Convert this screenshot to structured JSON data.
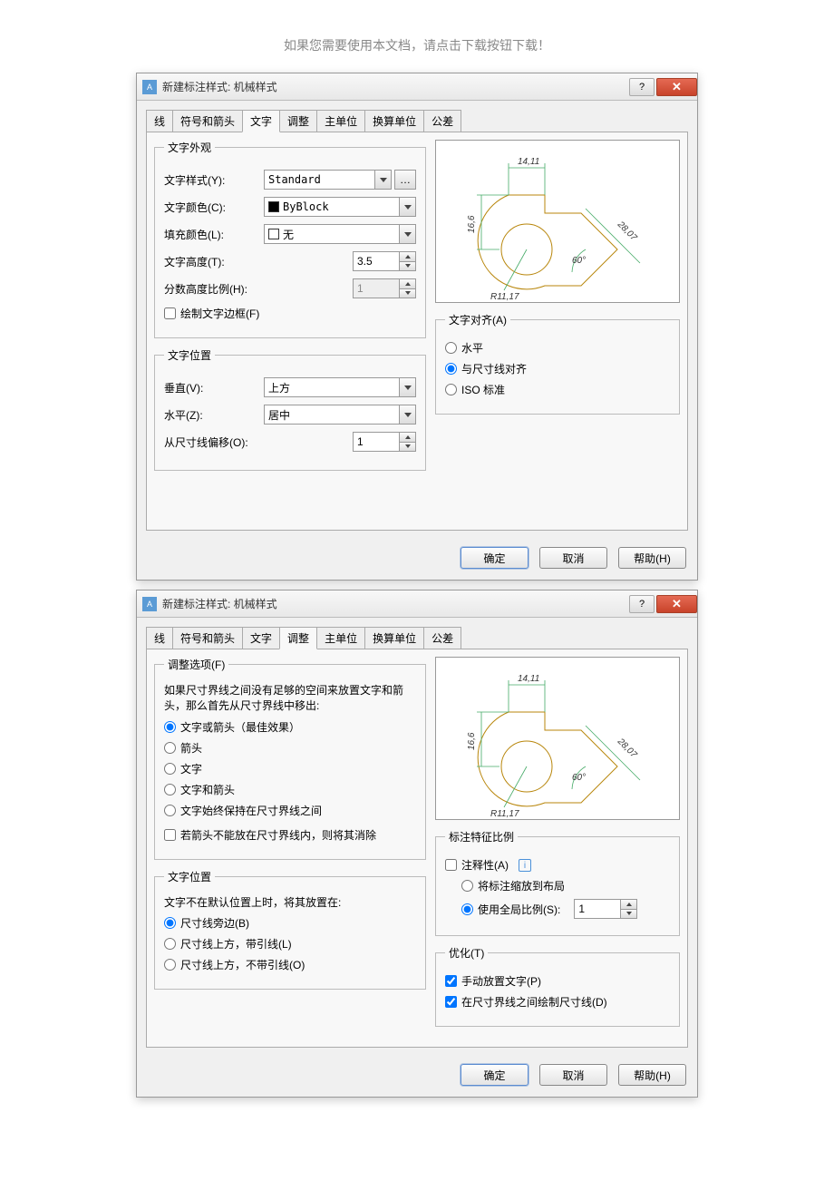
{
  "doc_notice": "如果您需要使用本文档，请点击下载按钮下载！",
  "dialog_title": "新建标注样式: 机械样式",
  "tabs": [
    "线",
    "符号和箭头",
    "文字",
    "调整",
    "主单位",
    "换算单位",
    "公差"
  ],
  "d1": {
    "active_tab": "文字",
    "appearance": {
      "legend": "文字外观",
      "style_label": "文字样式(Y):",
      "style_val": "Standard",
      "color_label": "文字颜色(C):",
      "color_val": "ByBlock",
      "fill_label": "填充颜色(L):",
      "fill_val": "无",
      "height_label": "文字高度(T):",
      "height_val": "3.5",
      "frac_label": "分数高度比例(H):",
      "frac_val": "1",
      "frame_check": "绘制文字边框(F)"
    },
    "position": {
      "legend": "文字位置",
      "vert_label": "垂直(V):",
      "vert_val": "上方",
      "horiz_label": "水平(Z):",
      "horiz_val": "居中",
      "offset_label": "从尺寸线偏移(O):",
      "offset_val": "1"
    },
    "align": {
      "legend": "文字对齐(A)",
      "opt1": "水平",
      "opt2": "与尺寸线对齐",
      "opt3": "ISO 标准"
    },
    "preview": {
      "d14": "14,11",
      "d16": "16,6",
      "d28": "28,07",
      "a60": "60°",
      "r11": "R11,17"
    }
  },
  "d2": {
    "active_tab": "调整",
    "fit": {
      "legend": "调整选项(F)",
      "intro": "如果尺寸界线之间没有足够的空间来放置文字和箭头，那么首先从尺寸界线中移出:",
      "opt1": "文字或箭头（最佳效果）",
      "opt2": "箭头",
      "opt3": "文字",
      "opt4": "文字和箭头",
      "opt5": "文字始终保持在尺寸界线之间",
      "suppress": "若箭头不能放在尺寸界线内，则将其消除"
    },
    "textpos": {
      "legend": "文字位置",
      "intro": "文字不在默认位置上时，将其放置在:",
      "opt1": "尺寸线旁边(B)",
      "opt2": "尺寸线上方，带引线(L)",
      "opt3": "尺寸线上方，不带引线(O)"
    },
    "scale": {
      "legend": "标注特征比例",
      "anno": "注释性(A)",
      "opt1": "将标注缩放到布局",
      "opt2": "使用全局比例(S):",
      "scale_val": "1"
    },
    "refine": {
      "legend": "优化(T)",
      "chk1": "手动放置文字(P)",
      "chk2": "在尺寸界线之间绘制尺寸线(D)"
    },
    "preview": {
      "d14": "14,11",
      "d16": "16,6",
      "d28": "28,07",
      "a60": "60°",
      "r11": "R11,17"
    }
  },
  "buttons": {
    "ok": "确定",
    "cancel": "取消",
    "help": "帮助(H)"
  }
}
